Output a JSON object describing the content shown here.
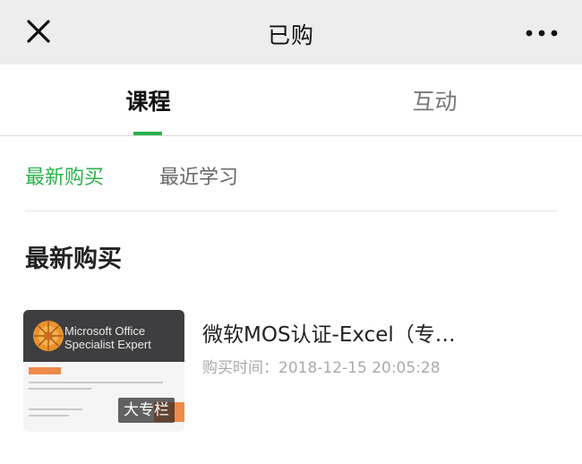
{
  "header": {
    "title": "已购",
    "close_icon": "close-icon",
    "more_icon": "more-icon"
  },
  "tabs": [
    {
      "label": "课程",
      "active": true
    },
    {
      "label": "互动",
      "active": false
    }
  ],
  "subtabs": [
    {
      "label": "最新购买",
      "active": true
    },
    {
      "label": "最近学习",
      "active": false
    }
  ],
  "section": {
    "title": "最新购买"
  },
  "courses": [
    {
      "title": "微软MOS认证-Excel（专…",
      "purchase_time": "购买时间：2018-12-15 20:05:28",
      "badge": "大专栏",
      "thumbnail_text": "Microsoft Office Specialist Expert"
    }
  ],
  "colors": {
    "accent": "#2bb24c",
    "header_bg": "#ededed",
    "thumb_orange": "#ef8a4a"
  }
}
